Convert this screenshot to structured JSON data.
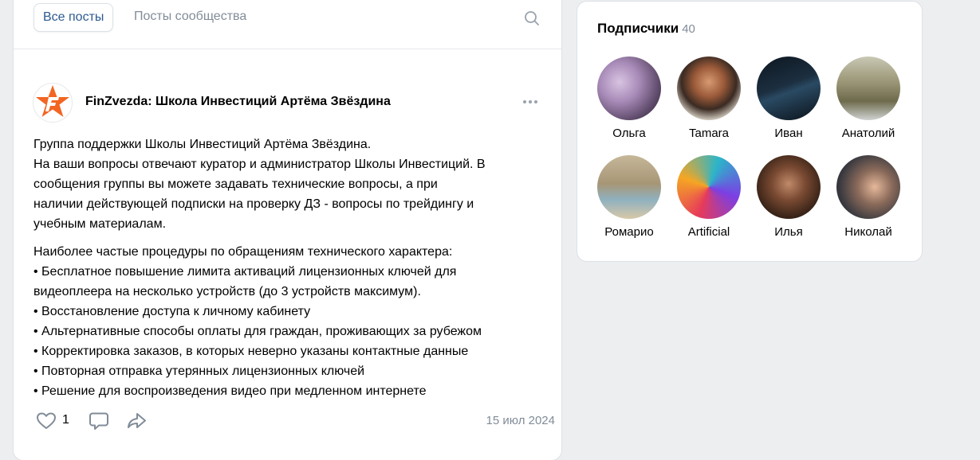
{
  "feed": {
    "tabs": [
      {
        "label": "Все посты"
      },
      {
        "label": "Посты сообщества"
      }
    ]
  },
  "post": {
    "author": "FinZvezda: Школа Инвестиций Артёма Звёздина",
    "paragraph1": [
      "Группа поддержки Школы Инвестиций Артёма Звёздина.",
      "На ваши вопросы отвечают куратор и администратор Школы Инвестиций. В",
      "сообщения группы вы можете задавать технические вопросы, а при",
      "наличии действующей подписки на проверку ДЗ - вопросы по трейдингу и",
      "учебным материалам."
    ],
    "paragraph2": [
      "Наиболее частые процедуры по обращениям технического характера:",
      "• Бесплатное повышение лимита активаций лицензионных ключей для",
      "видеоплеера на несколько устройств (до 3 устройств максимум).",
      "• Восстановление доступа к личному кабинету",
      "• Альтернативные способы оплаты для граждан, проживающих за рубежом",
      "• Корректировка заказов, в которых неверно указаны контактные данные",
      "• Повторная отправка утерянных лицензионных ключей",
      "• Решение для воспроизведения видео при медленном интернете"
    ],
    "likes": "1",
    "date": "15 июл 2024"
  },
  "subscribers": {
    "title": "Подписчики",
    "count": "40",
    "people": [
      {
        "name": "Ольга"
      },
      {
        "name": "Tamara"
      },
      {
        "name": "Иван"
      },
      {
        "name": "Анатолий"
      },
      {
        "name": "Ромарио"
      },
      {
        "name": "Artificial"
      },
      {
        "name": "Илья"
      },
      {
        "name": "Николай"
      }
    ]
  },
  "colors": {
    "accent": "#2c5a90",
    "secondary_text": "#818c99",
    "logo_orange": "#f26522"
  }
}
